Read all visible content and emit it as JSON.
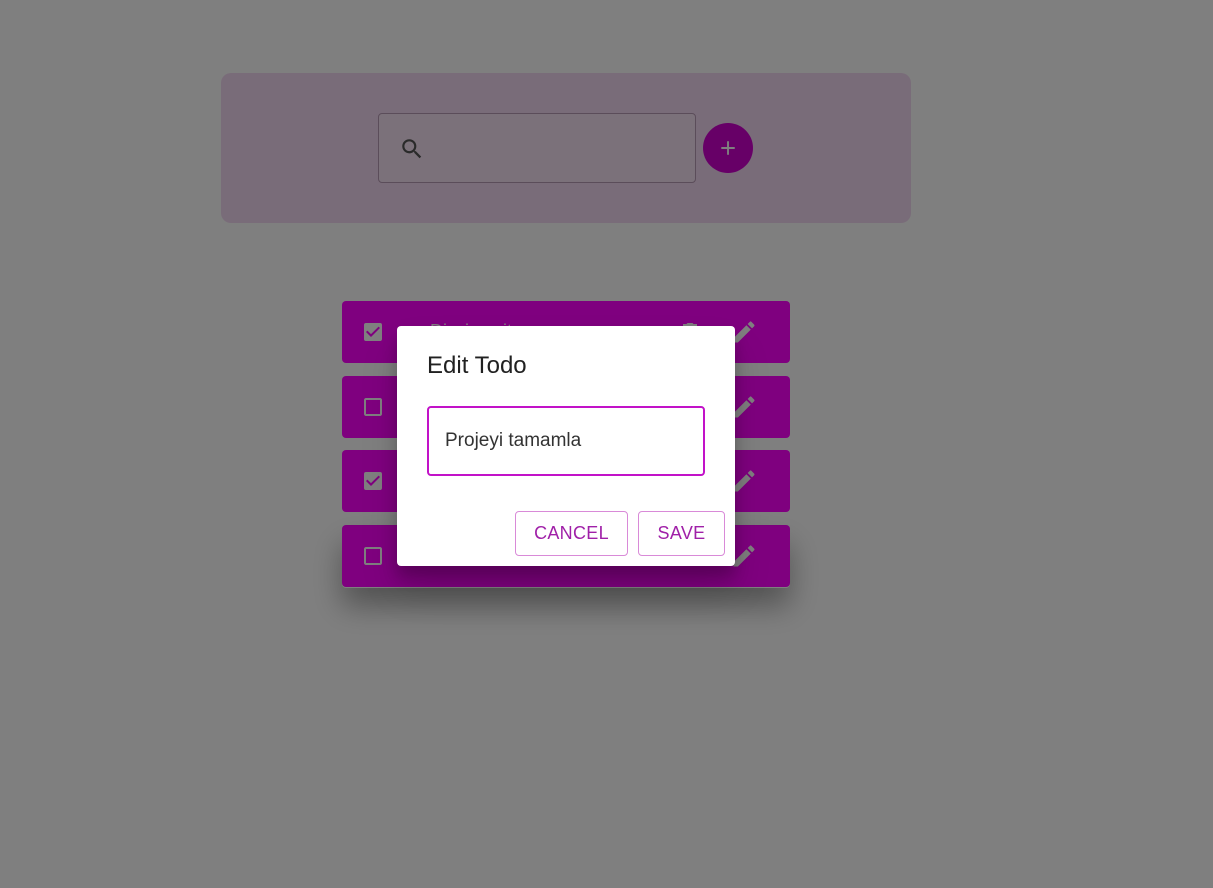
{
  "colors": {
    "accent": "#ff00ff",
    "header_bg": "#f3d9f2",
    "dialog_input_border": "#c212c8",
    "dialog_button_text": "#a020a8",
    "backdrop": "rgba(0,0,0,0.5)"
  },
  "header": {
    "search": {
      "placeholder": "",
      "value": "",
      "icon": "search-icon"
    },
    "add_button": {
      "icon": "plus-icon"
    }
  },
  "todos": [
    {
      "text": "Dişçiye git",
      "completed": true,
      "icons": [
        "checkbox-checked-icon",
        "trash-icon",
        "pencil-icon"
      ]
    },
    {
      "text": "",
      "completed": false,
      "icons": [
        "checkbox-empty-icon",
        "trash-icon",
        "pencil-icon"
      ]
    },
    {
      "text": "",
      "completed": true,
      "icons": [
        "checkbox-checked-icon",
        "trash-icon",
        "pencil-icon"
      ]
    },
    {
      "text": "",
      "completed": false,
      "icons": [
        "checkbox-empty-icon",
        "trash-icon",
        "pencil-icon"
      ]
    }
  ],
  "dialog": {
    "title": "Edit Todo",
    "input_value": "Projeyi tamamla",
    "cancel_label": "CANCEL",
    "save_label": "SAVE"
  }
}
